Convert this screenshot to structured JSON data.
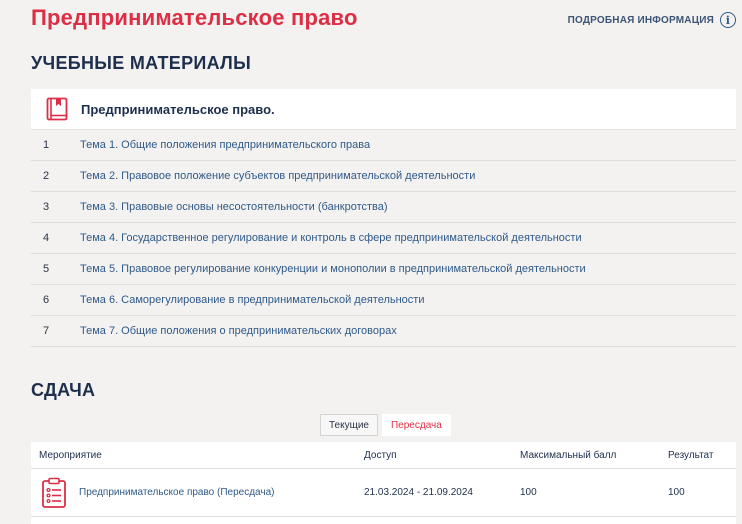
{
  "header": {
    "title": "Предпринимательское право",
    "more_info": "ПОДРОБНАЯ ИНФОРМАЦИЯ",
    "info_glyph": "i"
  },
  "materials": {
    "title": "УЧЕБНЫЕ МАТЕРИАЛЫ",
    "course_name": "Предпринимательское право.",
    "topics": [
      {
        "num": "1",
        "label": "Тема 1. Общие положения предпринимательского права"
      },
      {
        "num": "2",
        "label": "Тема 2. Правовое положение субъектов предпринимательской деятельности"
      },
      {
        "num": "3",
        "label": "Тема 3. Правовые основы несостоятельности (банкротства)"
      },
      {
        "num": "4",
        "label": "Тема 4. Государственное регулирование и контроль в сфере предпринимательской деятельности"
      },
      {
        "num": "5",
        "label": "Тема 5. Правовое регулирование конкуренции и монополии в предпринимательской деятельности"
      },
      {
        "num": "6",
        "label": "Тема 6. Саморегулирование в предпринимательской деятельности"
      },
      {
        "num": "7",
        "label": "Тема 7. Общие положения о предпринимательских договорах"
      }
    ]
  },
  "submission": {
    "title": "СДАЧА",
    "tabs": {
      "current": "Текущие",
      "retake": "Пересдача"
    },
    "columns": {
      "event": "Мероприятие",
      "access": "Доступ",
      "max_score": "Максимальный балл",
      "result": "Результат"
    },
    "rows": [
      {
        "event": "Предпринимательское право (Пересдача)",
        "access": "21.03.2024 - 21.09.2024",
        "max_score": "100",
        "result": "100"
      }
    ]
  },
  "colors": {
    "accent": "#dc2f45",
    "link": "#2f5a8a",
    "heading": "#1e2f4d",
    "background": "#f3f2f0"
  },
  "icons": {
    "course": "book-icon",
    "event": "clipboard-icon",
    "info": "info-icon"
  }
}
